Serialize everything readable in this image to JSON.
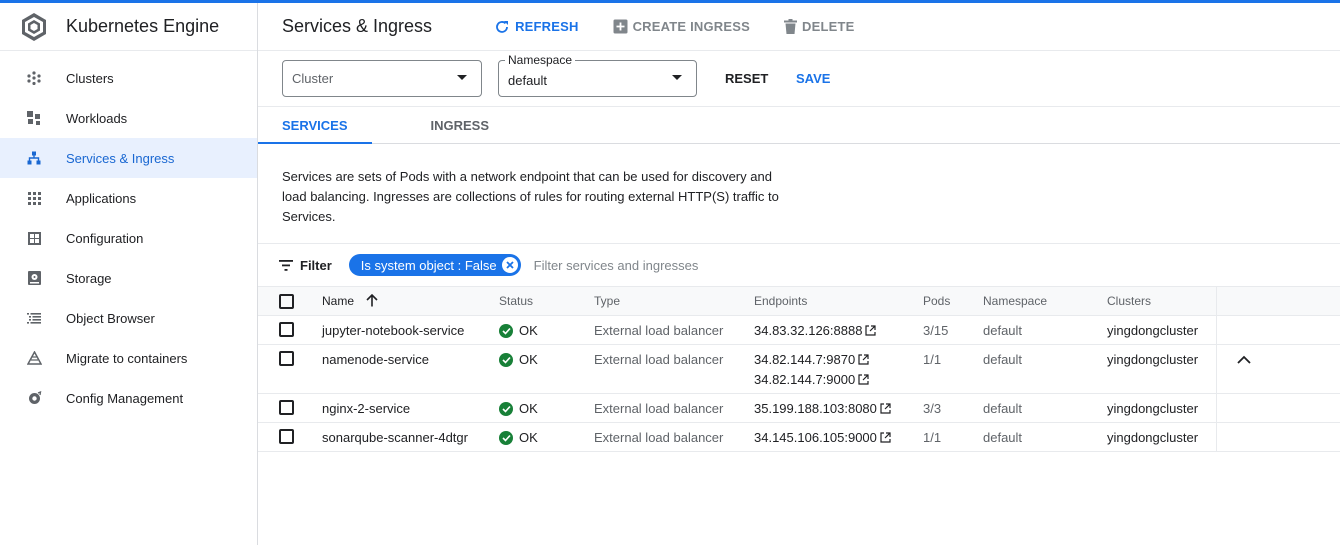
{
  "app": {
    "title": "Kubernetes Engine"
  },
  "sidebar": {
    "items": [
      {
        "label": "Clusters",
        "icon": "clusters-icon",
        "active": false
      },
      {
        "label": "Workloads",
        "icon": "workloads-icon",
        "active": false
      },
      {
        "label": "Services & Ingress",
        "icon": "services-icon",
        "active": true
      },
      {
        "label": "Applications",
        "icon": "applications-icon",
        "active": false
      },
      {
        "label": "Configuration",
        "icon": "configuration-icon",
        "active": false
      },
      {
        "label": "Storage",
        "icon": "storage-icon",
        "active": false
      },
      {
        "label": "Object Browser",
        "icon": "object-browser-icon",
        "active": false
      },
      {
        "label": "Migrate to containers",
        "icon": "migrate-icon",
        "active": false
      },
      {
        "label": "Config Management",
        "icon": "config-management-icon",
        "active": false
      }
    ]
  },
  "header": {
    "title": "Services & Ingress",
    "refresh_label": "REFRESH",
    "create_ingress_label": "CREATE INGRESS",
    "delete_label": "DELETE"
  },
  "filters": {
    "cluster_placeholder": "Cluster",
    "namespace_label": "Namespace",
    "namespace_value": "default",
    "reset_label": "RESET",
    "save_label": "SAVE"
  },
  "tabs": {
    "services": "SERVICES",
    "ingress": "INGRESS"
  },
  "description": "Services are sets of Pods with a network endpoint that can be used for discovery and load balancing. Ingresses are collections of rules for routing external HTTP(S) traffic to Services.",
  "filterbar": {
    "label": "Filter",
    "chip": "Is system object : False",
    "placeholder": "Filter services and ingresses"
  },
  "table": {
    "headers": {
      "name": "Name",
      "status": "Status",
      "type": "Type",
      "endpoints": "Endpoints",
      "pods": "Pods",
      "namespace": "Namespace",
      "clusters": "Clusters"
    },
    "rows": [
      {
        "name": "jupyter-notebook-service",
        "status": "OK",
        "type": "External load balancer",
        "endpoints": [
          "34.83.32.126:8888"
        ],
        "pods": "3/15",
        "namespace": "default",
        "cluster": "yingdongcluster"
      },
      {
        "name": "namenode-service",
        "status": "OK",
        "type": "External load balancer",
        "endpoints": [
          "34.82.144.7:9870",
          "34.82.144.7:9000"
        ],
        "pods": "1/1",
        "namespace": "default",
        "cluster": "yingdongcluster"
      },
      {
        "name": "nginx-2-service",
        "status": "OK",
        "type": "External load balancer",
        "endpoints": [
          "35.199.188.103:8080"
        ],
        "pods": "3/3",
        "namespace": "default",
        "cluster": "yingdongcluster"
      },
      {
        "name": "sonarqube-scanner-4dtgr",
        "status": "OK",
        "type": "External load balancer",
        "endpoints": [
          "34.145.106.105:9000"
        ],
        "pods": "1/1",
        "namespace": "default",
        "cluster": "yingdongcluster"
      }
    ]
  },
  "colors": {
    "accent": "#1a73e8",
    "active_bg": "#e8f0fe",
    "ok_green": "#188038"
  }
}
